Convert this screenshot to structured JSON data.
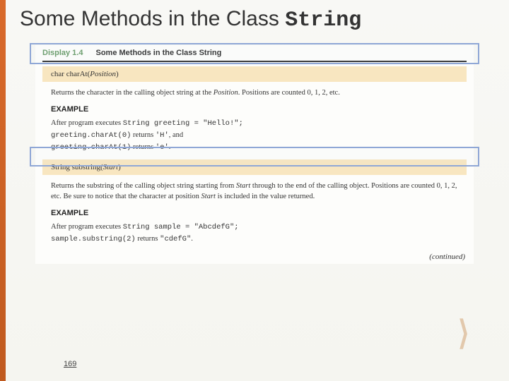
{
  "title": {
    "prefix": "Some Methods in the Class ",
    "code": "String"
  },
  "display": {
    "label": "Display 1.4",
    "caption": "Some Methods in the Class String"
  },
  "method1": {
    "sig_kw": "char",
    "sig_name": "charAt(",
    "sig_param": "Position",
    "sig_close": ")",
    "desc_a": "Returns the character in the calling object string at the ",
    "desc_param": "Position",
    "desc_b": ". Positions are counted 0, 1, 2, etc.",
    "example_label": "EXAMPLE",
    "ex_l1a": "After program executes ",
    "ex_l1b": "String greeting = \"Hello!\";",
    "ex_l2a": "greeting.charAt(0)",
    "ex_l2b": "  returns ",
    "ex_l2c": "'H'",
    "ex_l2d": ", and",
    "ex_l3a": "greeting.charAt(1)",
    "ex_l3b": "  returns ",
    "ex_l3c": "'e'",
    "ex_l3d": "."
  },
  "method2": {
    "sig_kw": "String",
    "sig_name": "substring(",
    "sig_param": "Start",
    "sig_close": ")",
    "desc_a": "Returns the substring of the calling object string starting from ",
    "desc_p1": "Start",
    "desc_b": " through to the end of the calling object. Positions are counted 0, 1, 2, etc. Be sure to notice that the character at position ",
    "desc_p2": "Start",
    "desc_c": " is included in the value returned.",
    "example_label": "EXAMPLE",
    "ex_l1a": "After program executes ",
    "ex_l1b": "String sample = \"AbcdefG\";",
    "ex_l2a": "sample.substring(2)",
    "ex_l2b": "  returns ",
    "ex_l2c": "\"cdefG\"",
    "ex_l2d": "."
  },
  "continued": "(continued)",
  "chevron": "❯",
  "page_number": "169"
}
